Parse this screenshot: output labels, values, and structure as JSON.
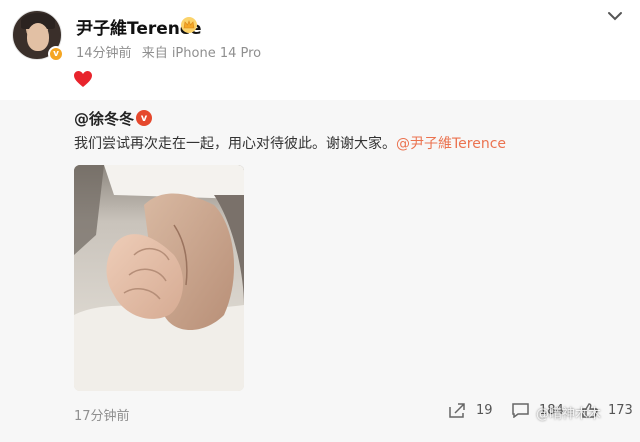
{
  "post": {
    "username": "尹子維Terence",
    "time": "14分钟前",
    "source": "来自 iPhone 14 Pro",
    "v_badge": "v"
  },
  "repost": {
    "username": "@徐冬冬",
    "v_badge": "v",
    "text": "我们尝试再次走在一起，用心对待彼此。谢谢大家。",
    "mention": "@尹子維Terence",
    "time": "17分钟前",
    "share_count": "19",
    "comment_count": "184",
    "like_count": "173"
  },
  "watermark": "@晴神木木",
  "colors": {
    "mention": "#eb7350",
    "crown": "#f5a623",
    "heart": "#e8242c",
    "badge_red": "#e5482d"
  }
}
